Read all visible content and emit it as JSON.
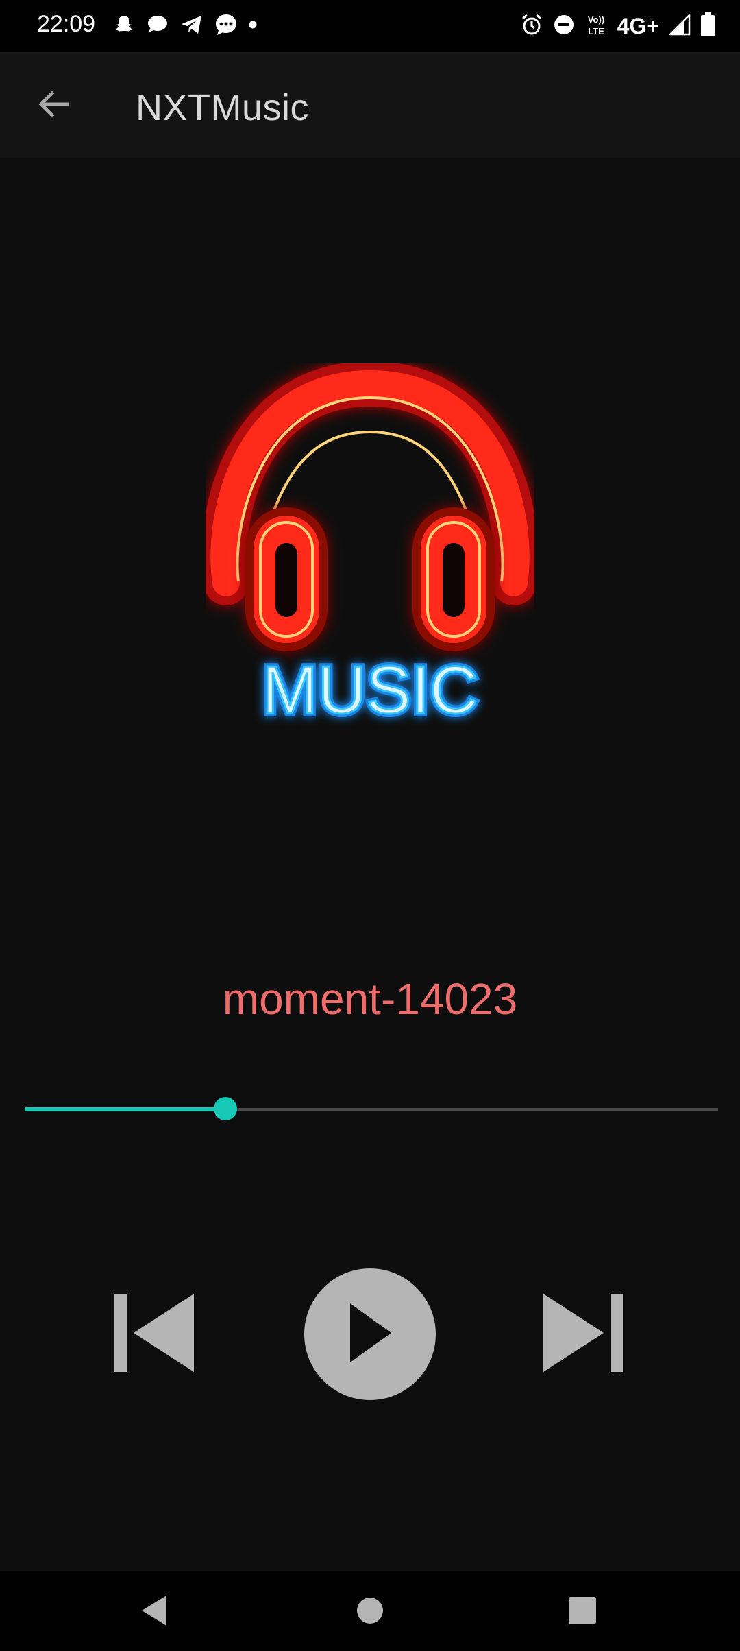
{
  "status_bar": {
    "time": "22:09",
    "left_icons": [
      "snapchat-icon",
      "chat-bubble-icon",
      "telegram-icon",
      "message-icon",
      "dot-icon"
    ],
    "right_icons": [
      "alarm-icon",
      "do-not-disturb-icon",
      "volte-icon",
      "network-type",
      "signal-icon",
      "battery-icon"
    ],
    "volte_label_top": "Vo))",
    "volte_label_bottom": "LTE",
    "network": "4G+"
  },
  "app_bar": {
    "title": "NXTMusic",
    "back_icon": "arrow-left-icon"
  },
  "artwork": {
    "caption": "MUSIC",
    "icon": "neon-headphones-icon"
  },
  "player": {
    "track_title": "moment-14023",
    "progress": 0.29,
    "state": "paused",
    "controls": [
      "skip-previous-icon",
      "play-icon",
      "skip-next-icon"
    ]
  },
  "nav_bar": {
    "buttons": [
      "nav-back-icon",
      "nav-home-icon",
      "nav-recents-icon"
    ]
  },
  "colors": {
    "background": "#0e0e0e",
    "app_bar": "#141414",
    "accent": "#19c9b8",
    "track_title": "#ef6c6c",
    "controls": "#b5b5b5",
    "headphones_neon": "#ff2a1a",
    "music_neon": "#38c6ff"
  }
}
